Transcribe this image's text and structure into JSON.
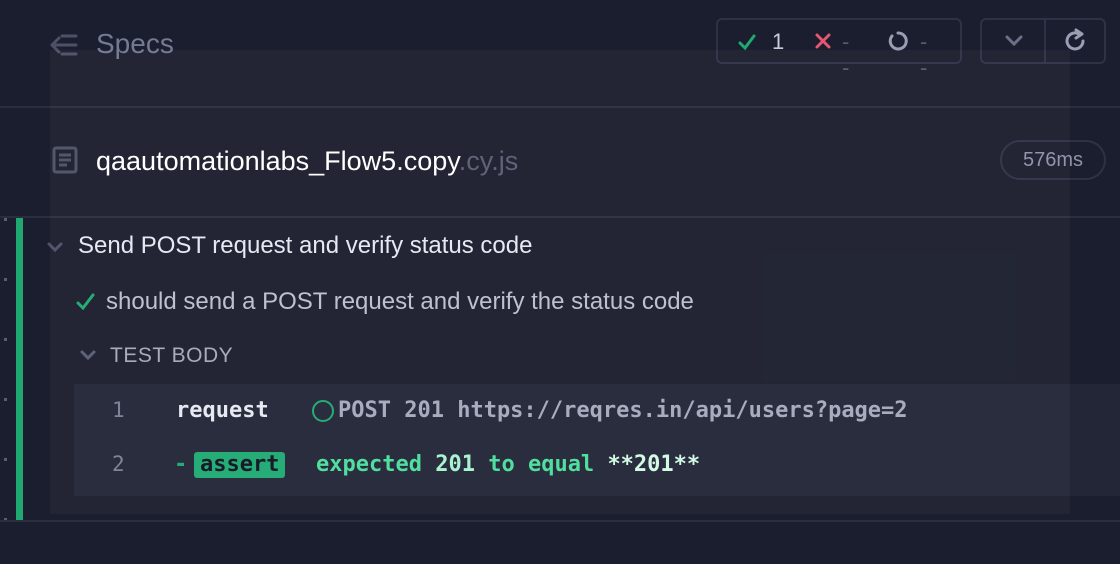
{
  "header": {
    "title": "Specs",
    "stats": {
      "passed": "1",
      "failed": "--",
      "pending": "--"
    }
  },
  "spec": {
    "name": "qaautomationlabs_Flow5.copy",
    "extension": ".cy.js",
    "duration": "576ms"
  },
  "suite": {
    "title": "Send POST request and verify status code",
    "test": {
      "title": "should send a POST request and verify the status code",
      "section_label": "TEST BODY",
      "commands": [
        {
          "num": "1",
          "name": "request",
          "message": "POST 201 https://reqres.in/api/users?page=2"
        },
        {
          "num": "2",
          "name": "assert",
          "msg_expected": "expected",
          "msg_value": "201",
          "msg_to_equal": "to equal",
          "msg_actual": "**201**"
        }
      ]
    }
  },
  "colors": {
    "pass": "#1fa971",
    "fail": "#e45770",
    "background": "#1b1e2e"
  },
  "icons": [
    "collapse-specs-icon",
    "check-icon",
    "x-icon",
    "pending-icon",
    "chevron-down-icon",
    "refresh-icon",
    "file-icon"
  ]
}
